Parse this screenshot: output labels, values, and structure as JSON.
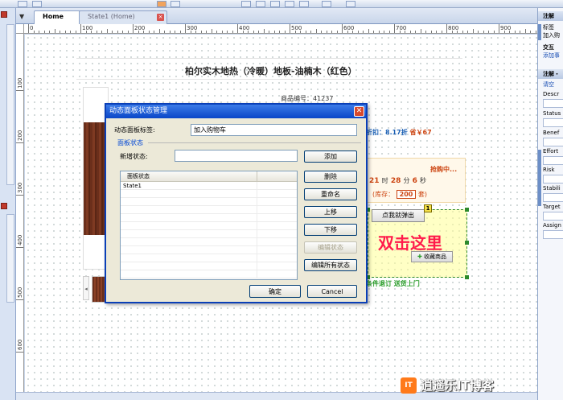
{
  "tabs": [
    {
      "label": "Home",
      "active": true
    },
    {
      "label": "State1 (Home)",
      "active": false
    }
  ],
  "ruler": {
    "h_marks": [
      "0",
      "100",
      "200",
      "300",
      "400",
      "500",
      "600",
      "700",
      "800",
      "900"
    ],
    "v_marks": [
      "100",
      "200",
      "300",
      "400",
      "500",
      "600"
    ]
  },
  "page": {
    "product_title": "柏尔实木地热（冷暖）地板-油楠木（红色）",
    "product_number": "商品编号：41237",
    "discount": "折扣：8.17折",
    "save_label": "省￥67",
    "flash_title": "抢购中...",
    "countdown": {
      "hours": "21",
      "h_unit": "时",
      "minutes": "28",
      "m_unit": "分",
      "seconds": "6",
      "s_unit": "秒"
    },
    "stock_prefix": "(库存：",
    "stock_value": "200",
    "stock_suffix": "套)",
    "buy_button": "点我就弹出",
    "fav_button": "收藏商品",
    "double_click_hint": "双击这里",
    "service_text": "条件退订 送货上门",
    "panel_badge": "1"
  },
  "dialog": {
    "title": "动态面板状态管理",
    "close_glyph": "✕",
    "panel_label_caption": "动态面板标签:",
    "panel_label_value": "加入购物车",
    "group_title": "面板状态",
    "new_state_caption": "新增状态:",
    "new_state_value": "",
    "list_header": "面板状态",
    "states": [
      "State1"
    ],
    "buttons": {
      "add": "添加",
      "delete": "删除",
      "rename": "重命名",
      "move_up": "上移",
      "move_down": "下移",
      "edit_state": "编辑状态",
      "edit_all": "编辑所有状态",
      "ok": "确定",
      "cancel": "Cancel"
    }
  },
  "right_panel": {
    "header1": "注解",
    "label1": "标签",
    "value1": "加入购",
    "header2": "交互",
    "link1": "添加事",
    "header3": "注解・",
    "link2": "请空",
    "fields": [
      "Descr",
      "Status",
      "Benef",
      "Effort",
      "Risk",
      "Stabili",
      "Target",
      "Assign"
    ]
  },
  "watermark": {
    "logo": "IT",
    "text": "逍遥乐IT博客"
  },
  "colors": {
    "title_bar": "#0a46c8",
    "hint_red": "#ff1a4b",
    "price_red": "#cc4411",
    "panel_green": "#2d8a2d"
  }
}
